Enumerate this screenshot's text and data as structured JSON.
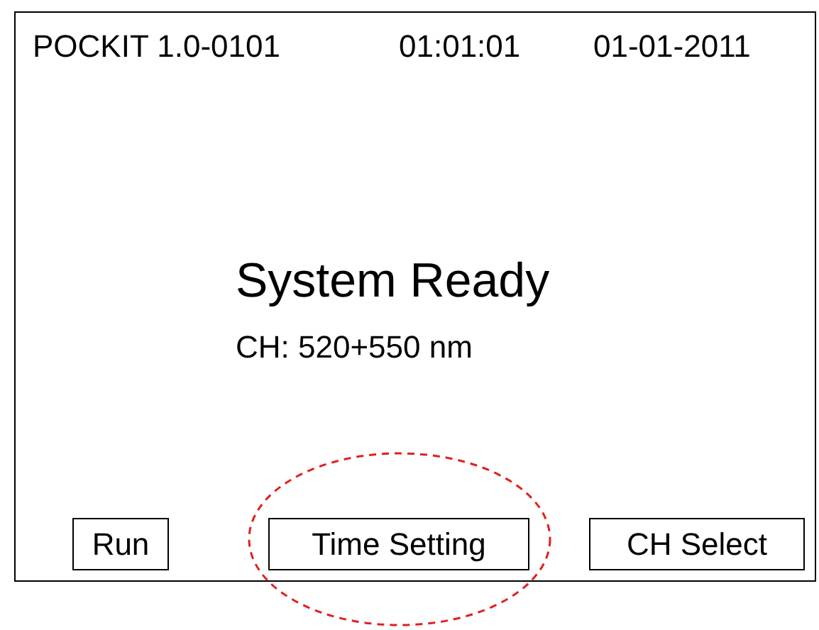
{
  "status_bar": {
    "device": "POCKIT 1.0-0101",
    "time": "01:01:01",
    "date": "01-01-2011"
  },
  "message": {
    "title": "System Ready",
    "channel": "CH: 520+550 nm"
  },
  "buttons": [
    {
      "label": "Run",
      "highlighted": false
    },
    {
      "label": "Time Setting",
      "highlighted": true
    },
    {
      "label": "CH Select",
      "highlighted": false
    }
  ]
}
